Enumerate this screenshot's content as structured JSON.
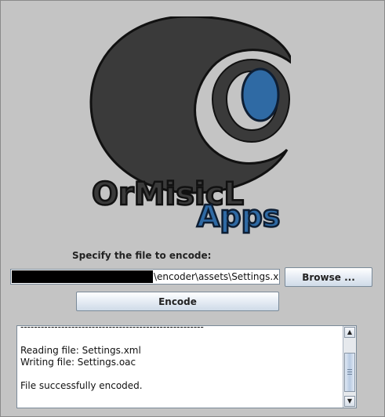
{
  "logo": {
    "line1": "OrMisicL",
    "line2": "Apps",
    "colors": {
      "dark": "#3a3a3a",
      "blue": "#2f6aa4"
    }
  },
  "form": {
    "prompt": "Specify the file to encode:",
    "path_value": "\\encoder\\assets\\Settings.xml",
    "browse_label": "Browse ...",
    "encode_label": "Encode"
  },
  "log": {
    "text": "------------------------------------------------------\n\nReading file: Settings.xml\nWriting file: Settings.oac\n\nFile successfully encoded."
  },
  "scrollbar": {
    "up_icon": "arrow-up-icon",
    "down_icon": "arrow-down-icon"
  }
}
